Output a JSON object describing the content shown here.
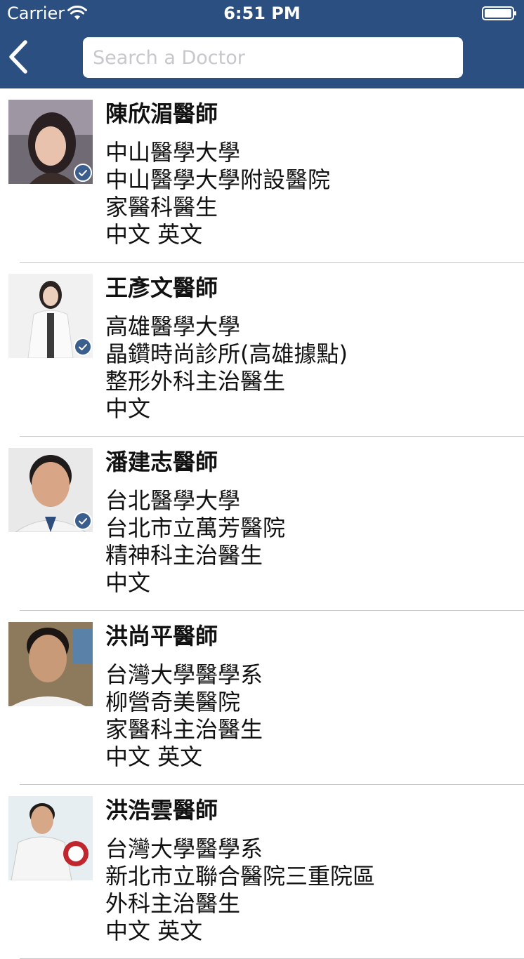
{
  "status_bar": {
    "carrier": "Carrier",
    "time": "6:51 PM"
  },
  "nav": {
    "search_placeholder": "Search a Doctor",
    "back_icon": "chevron-left-icon"
  },
  "colors": {
    "nav_background": "#2b4f80",
    "badge": "#3a5f8f",
    "divider": "#c8c7cc"
  },
  "doctors": [
    {
      "name": "陳欣湄醫師",
      "school": "中山醫學大學",
      "hospital": "中山醫學大學附設醫院",
      "title": "家醫科醫生",
      "languages": "中文 英文",
      "verified": true
    },
    {
      "name": "王彥文醫師",
      "school": "高雄醫學大學",
      "hospital": "晶鑽時尚診所(高雄據點)",
      "title": "整形外科主治醫生",
      "languages": "中文",
      "verified": true
    },
    {
      "name": "潘建志醫師",
      "school": "台北醫學大學",
      "hospital": "台北市立萬芳醫院",
      "title": "精神科主治醫生",
      "languages": "中文",
      "verified": true
    },
    {
      "name": "洪尚平醫師",
      "school": "台灣大學醫學系",
      "hospital": "柳營奇美醫院",
      "title": "家醫科主治醫生",
      "languages": "中文 英文",
      "verified": false
    },
    {
      "name": "洪浩雲醫師",
      "school": "台灣大學醫學系",
      "hospital": "新北市立聯合醫院三重院區",
      "title": "外科主治醫生",
      "languages": "中文 英文",
      "verified": false
    }
  ]
}
